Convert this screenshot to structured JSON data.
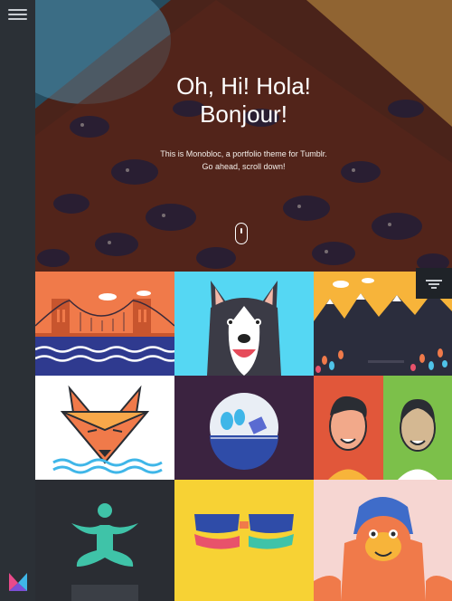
{
  "hero": {
    "title_line1": "Oh, Hi! Hola!",
    "title_line2": "Bonjour!",
    "text_line1": "This is Monobloc, a portfolio theme for Tumblr.",
    "text_line2": "Go ahead, scroll down!"
  },
  "icons": {
    "menu": "hamburger-menu-icon",
    "scroll": "mouse-scroll-icon",
    "filter": "filter-icon",
    "logo": "monobloc-logo"
  },
  "colors": {
    "sidebar": "#2b3036",
    "hero_bg": "#5a2a1f",
    "tile_orange": "#f07a4a",
    "tile_cyan": "#55d7f3",
    "tile_yellow": "#f7b43a",
    "tile_purple": "#3b2340",
    "tile_dark": "#2a2d33",
    "tile_red": "#e1573a"
  }
}
